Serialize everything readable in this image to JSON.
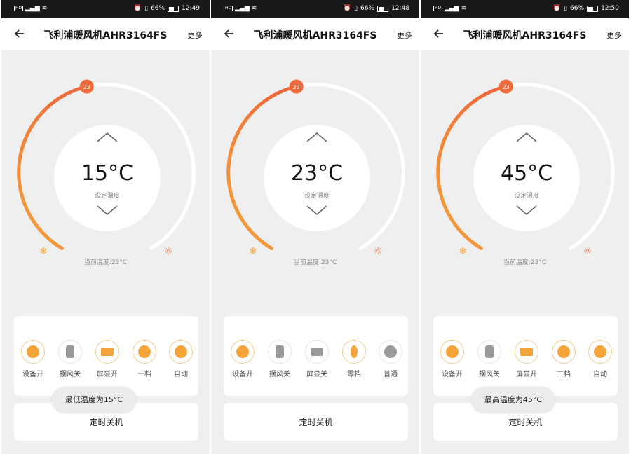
{
  "app": {
    "title": "飞利浦暖风机AHR3164FS",
    "more_label": "更多"
  },
  "labels": {
    "set_temp": "设定温度",
    "current_temp": "当前温度:23°C",
    "timer_off": "定时关机"
  },
  "colors": {
    "accent": "#f08a3e",
    "arc_start": "#f5a43a",
    "arc_end": "#ef6a3a",
    "cold_icon": "#f5a43a",
    "hot_icon": "#ef6a3a"
  },
  "phones": [
    {
      "status": {
        "battery": "66%",
        "time": "12:49"
      },
      "temperature": "15°C",
      "handle_value": "23",
      "controls": [
        {
          "label": "设备开",
          "icon": "power-icon",
          "active": true
        },
        {
          "label": "摆风关",
          "icon": "swing-icon",
          "active": false
        },
        {
          "label": "屏显开",
          "icon": "display-icon",
          "active": true
        },
        {
          "label": "一档",
          "icon": "fan-level-icon",
          "active": true
        },
        {
          "label": "自动",
          "icon": "auto-mode-icon",
          "active": true
        }
      ],
      "toast": "最低温度为15°C"
    },
    {
      "status": {
        "battery": "66%",
        "time": "12:48"
      },
      "temperature": "23°C",
      "handle_value": "23",
      "controls": [
        {
          "label": "设备开",
          "icon": "power-icon",
          "active": true
        },
        {
          "label": "摆风关",
          "icon": "swing-icon",
          "active": false
        },
        {
          "label": "屏显关",
          "icon": "display-icon",
          "active": false
        },
        {
          "label": "零档",
          "icon": "fan-level-icon",
          "active": true
        },
        {
          "label": "普通",
          "icon": "normal-mode-icon",
          "active": false
        }
      ],
      "toast": ""
    },
    {
      "status": {
        "battery": "66%",
        "time": "12:50"
      },
      "temperature": "45°C",
      "handle_value": "23",
      "controls": [
        {
          "label": "设备开",
          "icon": "power-icon",
          "active": true
        },
        {
          "label": "摆风关",
          "icon": "swing-icon",
          "active": false
        },
        {
          "label": "屏显开",
          "icon": "display-icon",
          "active": true
        },
        {
          "label": "二档",
          "icon": "fan-level-icon",
          "active": true
        },
        {
          "label": "自动",
          "icon": "auto-mode-icon",
          "active": true
        }
      ],
      "toast": "最高温度为45°C"
    }
  ]
}
